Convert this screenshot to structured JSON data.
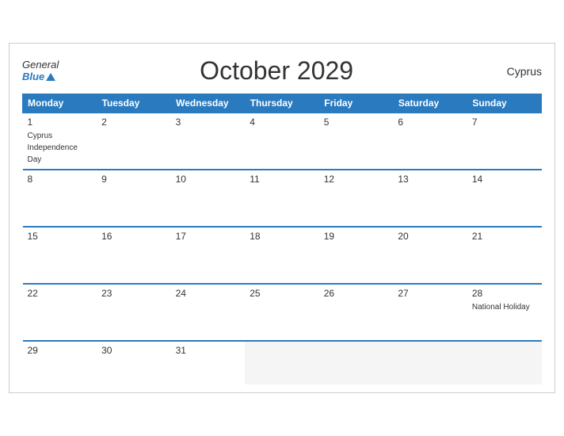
{
  "header": {
    "logo_general": "General",
    "logo_blue": "Blue",
    "title": "October 2029",
    "country": "Cyprus"
  },
  "weekdays": [
    "Monday",
    "Tuesday",
    "Wednesday",
    "Thursday",
    "Friday",
    "Saturday",
    "Sunday"
  ],
  "weeks": [
    [
      {
        "day": "1",
        "event": "Cyprus\nIndependence Day"
      },
      {
        "day": "2",
        "event": ""
      },
      {
        "day": "3",
        "event": ""
      },
      {
        "day": "4",
        "event": ""
      },
      {
        "day": "5",
        "event": ""
      },
      {
        "day": "6",
        "event": ""
      },
      {
        "day": "7",
        "event": ""
      }
    ],
    [
      {
        "day": "8",
        "event": ""
      },
      {
        "day": "9",
        "event": ""
      },
      {
        "day": "10",
        "event": ""
      },
      {
        "day": "11",
        "event": ""
      },
      {
        "day": "12",
        "event": ""
      },
      {
        "day": "13",
        "event": ""
      },
      {
        "day": "14",
        "event": ""
      }
    ],
    [
      {
        "day": "15",
        "event": ""
      },
      {
        "day": "16",
        "event": ""
      },
      {
        "day": "17",
        "event": ""
      },
      {
        "day": "18",
        "event": ""
      },
      {
        "day": "19",
        "event": ""
      },
      {
        "day": "20",
        "event": ""
      },
      {
        "day": "21",
        "event": ""
      }
    ],
    [
      {
        "day": "22",
        "event": ""
      },
      {
        "day": "23",
        "event": ""
      },
      {
        "day": "24",
        "event": ""
      },
      {
        "day": "25",
        "event": ""
      },
      {
        "day": "26",
        "event": ""
      },
      {
        "day": "27",
        "event": ""
      },
      {
        "day": "28",
        "event": "National Holiday"
      }
    ],
    [
      {
        "day": "29",
        "event": ""
      },
      {
        "day": "30",
        "event": ""
      },
      {
        "day": "31",
        "event": ""
      },
      {
        "day": "",
        "event": ""
      },
      {
        "day": "",
        "event": ""
      },
      {
        "day": "",
        "event": ""
      },
      {
        "day": "",
        "event": ""
      }
    ]
  ]
}
